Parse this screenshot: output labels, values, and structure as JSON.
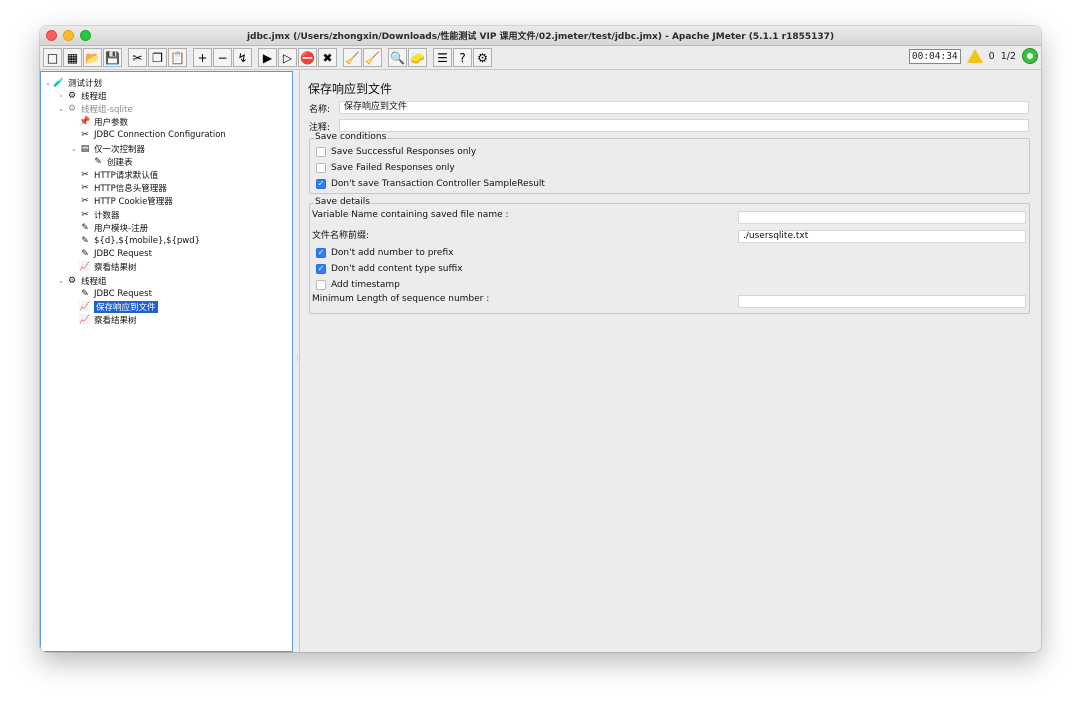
{
  "window": {
    "title": "jdbc.jmx (/Users/zhongxin/Downloads/性能测试 VIP 课用文件/02.jmeter/test/jdbc.jmx) - Apache JMeter (5.1.1 r1855137)"
  },
  "toolbar": {
    "buttons": [
      {
        "name": "new-icon",
        "glyph": "□"
      },
      {
        "name": "templates-icon",
        "glyph": "▦"
      },
      {
        "name": "open-icon",
        "glyph": "📂"
      },
      {
        "name": "save-icon",
        "glyph": "💾"
      },
      {
        "name": "cut-icon",
        "glyph": "✂"
      },
      {
        "name": "copy-icon",
        "glyph": "❐"
      },
      {
        "name": "paste-icon",
        "glyph": "📋"
      },
      {
        "name": "expand-icon",
        "glyph": "+"
      },
      {
        "name": "collapse-icon",
        "glyph": "−"
      },
      {
        "name": "toggle-icon",
        "glyph": "↯"
      },
      {
        "name": "start-icon",
        "glyph": "▶"
      },
      {
        "name": "start-no-pause-icon",
        "glyph": "▷"
      },
      {
        "name": "stop-icon",
        "glyph": "⛔"
      },
      {
        "name": "shutdown-icon",
        "glyph": "✖"
      },
      {
        "name": "clear-icon",
        "glyph": "🧹"
      },
      {
        "name": "clear-all-icon",
        "glyph": "🧹"
      },
      {
        "name": "search-icon",
        "glyph": "🔍"
      },
      {
        "name": "reset-search-icon",
        "glyph": "🧽"
      },
      {
        "name": "function-helper-icon",
        "glyph": "☰"
      },
      {
        "name": "help-icon",
        "glyph": "?"
      },
      {
        "name": "remote-icon",
        "glyph": "⚙"
      }
    ],
    "timer": "00:04:34",
    "warning_count": "0",
    "threads": "1/2"
  },
  "tree": [
    {
      "label": "测试计划",
      "indent": 0,
      "arrow": "⌄",
      "icon": "🧪",
      "gray": false,
      "selected": false
    },
    {
      "label": "线程组",
      "indent": 1,
      "arrow": "›",
      "icon": "⚙",
      "gray": false,
      "selected": false
    },
    {
      "label": "线程组-sqlite",
      "indent": 1,
      "arrow": "⌄",
      "icon": "⚙",
      "gray": true,
      "selected": false
    },
    {
      "label": "用户参数",
      "indent": 2,
      "arrow": "",
      "icon": "📌",
      "gray": false,
      "selected": false
    },
    {
      "label": "JDBC Connection Configuration",
      "indent": 2,
      "arrow": "",
      "icon": "✂",
      "gray": false,
      "selected": false
    },
    {
      "label": "仅一次控制器",
      "indent": 2,
      "arrow": "⌄",
      "icon": "▤",
      "gray": false,
      "selected": false
    },
    {
      "label": "创建表",
      "indent": 3,
      "arrow": "",
      "icon": "✎",
      "gray": false,
      "selected": false
    },
    {
      "label": "HTTP请求默认值",
      "indent": 2,
      "arrow": "",
      "icon": "✂",
      "gray": false,
      "selected": false
    },
    {
      "label": "HTTP信息头管理器",
      "indent": 2,
      "arrow": "",
      "icon": "✂",
      "gray": false,
      "selected": false
    },
    {
      "label": "HTTP Cookie管理器",
      "indent": 2,
      "arrow": "",
      "icon": "✂",
      "gray": false,
      "selected": false
    },
    {
      "label": "计数器",
      "indent": 2,
      "arrow": "",
      "icon": "✂",
      "gray": false,
      "selected": false
    },
    {
      "label": "用户模块-注册",
      "indent": 2,
      "arrow": "",
      "icon": "✎",
      "gray": false,
      "selected": false
    },
    {
      "label": "${d},${mobile},${pwd}",
      "indent": 2,
      "arrow": "",
      "icon": "✎",
      "gray": false,
      "selected": false
    },
    {
      "label": "JDBC Request",
      "indent": 2,
      "arrow": "",
      "icon": "✎",
      "gray": false,
      "selected": false
    },
    {
      "label": "察看结果树",
      "indent": 2,
      "arrow": "",
      "icon": "📈",
      "gray": false,
      "selected": false
    },
    {
      "label": "线程组",
      "indent": 1,
      "arrow": "⌄",
      "icon": "⚙",
      "gray": false,
      "selected": false
    },
    {
      "label": "JDBC Request",
      "indent": 2,
      "arrow": "",
      "icon": "✎",
      "gray": false,
      "selected": false
    },
    {
      "label": "保存响应到文件",
      "indent": 2,
      "arrow": "",
      "icon": "📈",
      "gray": false,
      "selected": true
    },
    {
      "label": "察看结果树",
      "indent": 2,
      "arrow": "",
      "icon": "📈",
      "gray": false,
      "selected": false
    }
  ],
  "panel": {
    "title": "保存响应到文件",
    "name_label": "名称:",
    "name_value": "保存响应到文件",
    "comment_label": "注释:",
    "comment_value": "",
    "save_conditions": {
      "legend": "Save conditions",
      "options": [
        {
          "label": "Save Successful Responses only",
          "checked": false
        },
        {
          "label": "Save Failed Responses only",
          "checked": false
        },
        {
          "label": "Don't save Transaction Controller SampleResult",
          "checked": true
        }
      ]
    },
    "save_details": {
      "legend": "Save details",
      "variable_name_label": "Variable Name containing saved file name :",
      "variable_name_value": "",
      "prefix_label": "文件名称前缀:",
      "prefix_value": "./usersqlite.txt",
      "options": [
        {
          "label": "Don't add number to prefix",
          "checked": true
        },
        {
          "label": "Don't add content type suffix",
          "checked": true
        },
        {
          "label": "Add timestamp",
          "checked": false
        }
      ],
      "min_length_label": "Minimum Length of sequence number :",
      "min_length_value": ""
    }
  }
}
